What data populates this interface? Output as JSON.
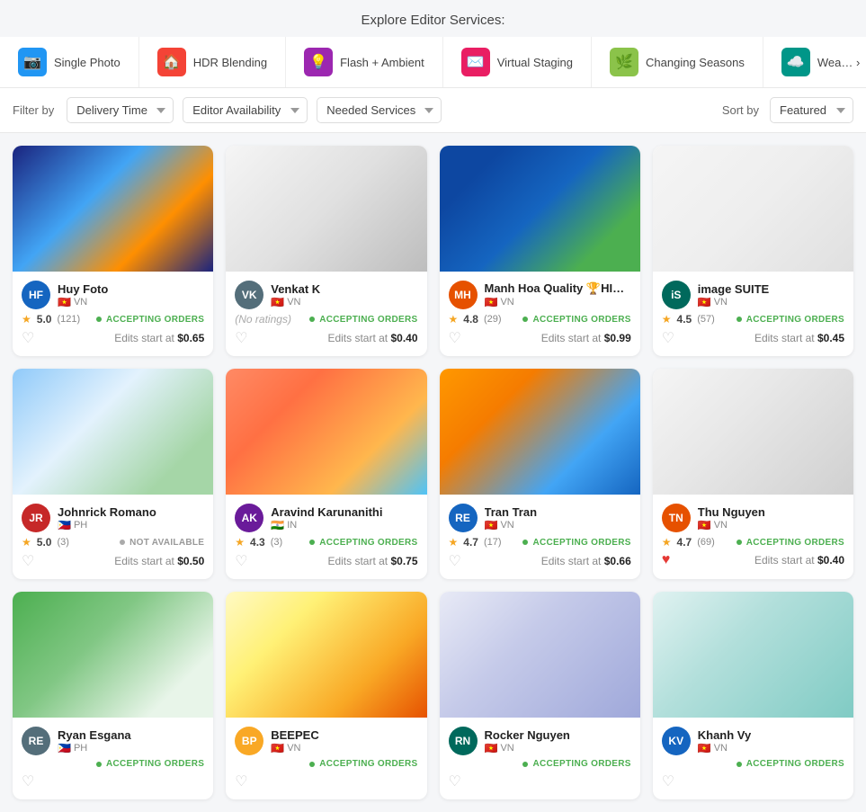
{
  "page": {
    "title": "Explore Editor Services:"
  },
  "services": [
    {
      "id": "single-photo",
      "label": "Single Photo",
      "icon": "📷",
      "color": "service-icon-blue"
    },
    {
      "id": "hdr-blending",
      "label": "HDR Blending",
      "icon": "🏠",
      "color": "service-icon-red"
    },
    {
      "id": "flash-ambient",
      "label": "Flash + Ambient",
      "icon": "💡",
      "color": "service-icon-purple"
    },
    {
      "id": "virtual-staging",
      "label": "Virtual Staging",
      "icon": "✉️",
      "color": "service-icon-pink"
    },
    {
      "id": "changing-seasons",
      "label": "Changing Seasons",
      "icon": "🌿",
      "color": "service-icon-green"
    },
    {
      "id": "weather",
      "label": "Wea… ›",
      "icon": "☁️",
      "color": "service-icon-teal"
    }
  ],
  "filters": {
    "label": "Filter by",
    "delivery_time": {
      "label": "Delivery Time",
      "value": "Delivery Time"
    },
    "editor_availability": {
      "label": "Editor Availability",
      "value": "Editor Availability"
    },
    "needed_services": {
      "label": "Needed Services",
      "value": "Needed Services"
    },
    "sort_label": "Sort by",
    "sort_value": "Featured"
  },
  "cards": [
    {
      "id": 1,
      "img": "img-1",
      "name": "Huy Foto",
      "country": "VN",
      "flag": "🇻🇳",
      "avatar_color": "avatar-blue",
      "avatar_text": "HF",
      "rating": "5.0",
      "count": "(121)",
      "has_rating": true,
      "status": "accepting",
      "status_text": "ACCEPTING ORDERS",
      "price": "$0.65",
      "liked": false
    },
    {
      "id": 2,
      "img": "img-2",
      "name": "Venkat K",
      "country": "VN",
      "flag": "🇻🇳",
      "avatar_color": "avatar-gray",
      "avatar_text": "VK",
      "rating": null,
      "count": "(No ratings)",
      "has_rating": false,
      "status": "accepting",
      "status_text": "ACCEPTING ORDERS",
      "price": "$0.40",
      "liked": false
    },
    {
      "id": 3,
      "img": "img-3",
      "name": "Manh Hoa Quality 🏆HIGH – END +",
      "country": "VN",
      "flag": "🇻🇳",
      "avatar_color": "avatar-orange",
      "avatar_text": "MH",
      "rating": "4.8",
      "count": "(29)",
      "has_rating": true,
      "status": "accepting",
      "status_text": "ACCEPTING ORDERS",
      "price": "$0.99",
      "liked": false
    },
    {
      "id": 4,
      "img": "img-4",
      "name": "image SUITE",
      "country": "VN",
      "flag": "🇻🇳",
      "avatar_color": "avatar-teal",
      "avatar_text": "iS",
      "rating": "4.5",
      "count": "(57)",
      "has_rating": true,
      "status": "accepting",
      "status_text": "ACCEPTING ORDERS",
      "price": "$0.45",
      "liked": false
    },
    {
      "id": 5,
      "img": "img-5",
      "name": "Johnrick Romano",
      "country": "PH",
      "flag": "🇵🇭",
      "avatar_color": "avatar-red",
      "avatar_text": "JR",
      "rating": "5.0",
      "count": "(3)",
      "has_rating": true,
      "status": "not",
      "status_text": "NOT AVAILABLE",
      "price": "$0.50",
      "liked": false
    },
    {
      "id": 6,
      "img": "img-6",
      "name": "Aravind Karunanithi",
      "country": "IN",
      "flag": "🇮🇳",
      "avatar_color": "avatar-purple",
      "avatar_text": "AK",
      "rating": "4.3",
      "count": "(3)",
      "has_rating": true,
      "status": "accepting",
      "status_text": "ACCEPTING ORDERS",
      "price": "$0.75",
      "liked": false
    },
    {
      "id": 7,
      "img": "img-7",
      "name": "Tran Tran",
      "country": "VN",
      "flag": "🇻🇳",
      "avatar_color": "avatar-blue",
      "avatar_text": "RE",
      "rating": "4.7",
      "count": "(17)",
      "has_rating": true,
      "status": "accepting",
      "status_text": "ACCEPTING ORDERS",
      "price": "$0.66",
      "liked": false
    },
    {
      "id": 8,
      "img": "img-8",
      "name": "Thu Nguyen",
      "country": "VN",
      "flag": "🇻🇳",
      "avatar_color": "avatar-orange",
      "avatar_text": "TN",
      "rating": "4.7",
      "count": "(69)",
      "has_rating": true,
      "status": "accepting",
      "status_text": "ACCEPTING ORDERS",
      "price": "$0.40",
      "liked": true
    },
    {
      "id": 9,
      "img": "img-9",
      "name": "Ryan Esgana",
      "country": "PH",
      "flag": "🇵🇭",
      "avatar_color": "avatar-gray",
      "avatar_text": "RE",
      "rating": null,
      "count": null,
      "has_rating": false,
      "status": "accepting",
      "status_text": "ACCEPTING ORDERS",
      "price": null,
      "liked": false
    },
    {
      "id": 10,
      "img": "img-10",
      "name": "BEEPEC",
      "country": "VN",
      "flag": "🇻🇳",
      "avatar_color": "avatar-yellow",
      "avatar_text": "BP",
      "rating": null,
      "count": null,
      "has_rating": false,
      "status": "accepting",
      "status_text": "ACCEPTING ORDERS",
      "price": null,
      "liked": false
    },
    {
      "id": 11,
      "img": "img-11",
      "name": "Rocker Nguyen",
      "country": "VN",
      "flag": "🇻🇳",
      "avatar_color": "avatar-teal",
      "avatar_text": "RN",
      "rating": null,
      "count": null,
      "has_rating": false,
      "status": "accepting",
      "status_text": "ACCEPTING ORDERS",
      "price": null,
      "liked": false
    },
    {
      "id": 12,
      "img": "img-12",
      "name": "Khanh Vy",
      "country": "VN",
      "flag": "🇻🇳",
      "avatar_color": "avatar-blue",
      "avatar_text": "KV",
      "rating": null,
      "count": null,
      "has_rating": false,
      "status": "accepting",
      "status_text": "ACCEPTING ORDERS",
      "price": null,
      "liked": false
    }
  ]
}
